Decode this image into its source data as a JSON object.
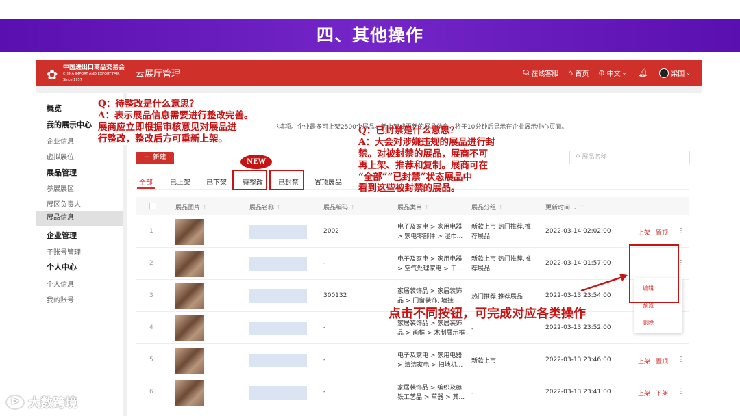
{
  "slide_title": "四、其他操作",
  "header": {
    "logo_cn": "中国进出口商品交易会",
    "logo_en": "CHINA IMPORT AND EXPORT FAIR",
    "logo_since": "Since 1957",
    "app_title": "云展厅管理",
    "service": "在线客服",
    "home": "首页",
    "language": "中文",
    "user": "梁国"
  },
  "sidebar": {
    "overview": "概览",
    "my_center": "我的展示中心",
    "company_info": "企业信息",
    "virtual_booth": "虚拟展位",
    "exhibit_mgmt": "展品管理",
    "join_area": "参展展区",
    "area_head": "展区负责人",
    "exhibit_info": "展品信息",
    "company_mgmt": "企业管理",
    "sub_account": "子账号管理",
    "personal": "个人中心",
    "personal_info": "个人信息",
    "my_account": "我的账号"
  },
  "notice": "必填项。企业最多可上架2500个展品。新上架或更新的展品信息，将于10分钟后显示在企业展示中心页面。",
  "new_button": "新建",
  "search_placeholder": "展品名称",
  "tabs": [
    "全部",
    "已上架",
    "已下架",
    "待整改",
    "已封禁",
    "置顶展品"
  ],
  "new_badge": "NEW",
  "columns": [
    "展品图片",
    "展品名称",
    "展品编码",
    "展品类目",
    "展品分组",
    "更新时间"
  ],
  "rows": [
    {
      "no": "1",
      "code": "2002",
      "cat1": "电子及家电 > 家用电器",
      "cat2": "> 家电零部件 > 湿巾...",
      "group1": "新款上市,热门推荐,推",
      "group2": "荐展品",
      "time": "2022-03-14 02:02:00",
      "a1": "上架",
      "a2": "置顶"
    },
    {
      "no": "2",
      "code": "-",
      "cat1": "电子及家电 > 家用电器",
      "cat2": "> 空气处理家电 > 干...",
      "group1": "新款上市,热门推荐,推",
      "group2": "荐展品",
      "time": "2022-03-14 01:57:00",
      "a1": "",
      "a2": ""
    },
    {
      "no": "3",
      "code": "300132",
      "cat1": "家居装饰品 > 家居装饰",
      "cat2": "品 > 门窗装饰, 墙挂...",
      "group1": "热门推荐,推荐展品",
      "group2": "",
      "time": "2022-03-13 23:54:00",
      "a1": "",
      "a2": ""
    },
    {
      "no": "4",
      "code": "-",
      "cat1": "家居装饰品 > 家居装饰",
      "cat2": "品 > 画框 > 木制展示框",
      "group1": "-",
      "group2": "",
      "time": "2022-03-13 23:52:00",
      "a1": "上架",
      "a2": "置顶"
    },
    {
      "no": "5",
      "code": "-",
      "cat1": "电子及家电 > 家用电器",
      "cat2": "> 清洁家电 > 扫地机...",
      "group1": "新款上市",
      "group2": "",
      "time": "2022-03-13 23:46:00",
      "a1": "上架",
      "a2": "置顶"
    },
    {
      "no": "6",
      "code": "-",
      "cat1": "家居装饰品 > 编织及藤",
      "cat2": "铁工艺品 > 草器 > 其...",
      "group1": "-",
      "group2": "",
      "time": "2022-03-13 23:41:00",
      "a1": "上架",
      "a2": "下架"
    }
  ],
  "dropdown": [
    "编辑",
    "预览",
    "删除"
  ],
  "annotation1": [
    "Q：待整改是什么意思？",
    "A：表示展品信息需要进行整改完善。",
    "展商应立即根据审核意见对展品进",
    "行整改，整改后方可重新上架。"
  ],
  "annotation2": [
    "Q：已封禁是什么意思？",
    "A：大会对涉嫌违规的展品进行封",
    "禁。对被封禁的展品，展商不可",
    "再上架、推荐和复制。展商可在",
    "“全部”“已封禁”状态展品中",
    "看到这些被封禁的展品。"
  ],
  "annotation3": "点击不同按钮，可完成对应各类操作",
  "watermark": "大数跨境",
  "colors": {
    "brand_red": "#d0302a",
    "annotation_red": "#c91313",
    "banner_purple": "#6a1cbf"
  }
}
